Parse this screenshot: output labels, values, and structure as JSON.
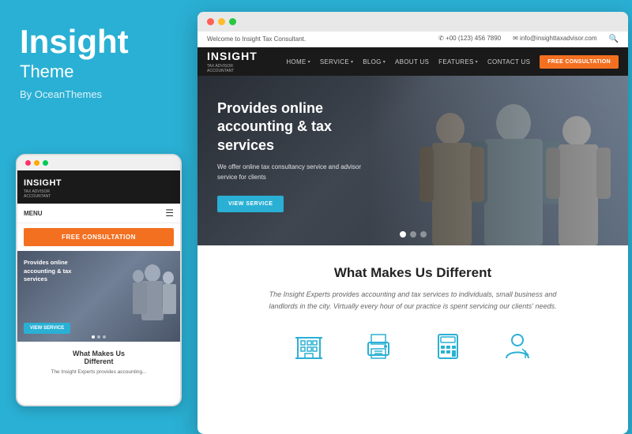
{
  "brand": {
    "title": "Insight",
    "subtitle": "Theme",
    "by": "By OceanThemes"
  },
  "mobile": {
    "logo": "INSIGHT",
    "logo_sub": "TAX ADVISOR\nACCOUNTANT",
    "menu_label": "MENU",
    "cta_btn": "FREE CONSULTATION",
    "hero_title": "Provides online accounting & tax services",
    "hero_btn": "VIEW SERVICE",
    "section_title": "What Makes Us\nDifferent"
  },
  "browser": {
    "topbar_welcome": "Welcome to Insight Tax Consultant.",
    "topbar_phone": "✆ +00 (123) 456 7890",
    "topbar_email": "✉ info@insighttaxadvisor.com",
    "logo": "INSIGHT",
    "logo_sub1": "TAX ADVISOR",
    "logo_sub2": "ACCOUNTANT",
    "nav": {
      "home": "HOME",
      "service": "SERVICE",
      "blog": "BLOG",
      "about": "ABOUT US",
      "features": "FEATURES",
      "contact": "CONTACT US",
      "cta": "FREE CONSULTATION"
    },
    "hero": {
      "title": "Provides online accounting & tax services",
      "subtitle": "We offer online tax consultancy service and advisor service for clients",
      "btn": "VIEW SERVICE"
    },
    "section": {
      "title": "What Makes Us Different",
      "text": "The Insight Experts provides accounting and tax services to individuals, small business and landlords in the city. Virtually every hour of our practice is spent servicing our clients' needs."
    },
    "icons": [
      {
        "name": "building-icon",
        "label": ""
      },
      {
        "name": "printer-icon",
        "label": ""
      },
      {
        "name": "calculator-icon",
        "label": ""
      },
      {
        "name": "person-icon",
        "label": ""
      }
    ]
  },
  "colors": {
    "accent": "#2ab0d4",
    "cta": "#f37021",
    "dark": "#1a1a1a",
    "text": "#333333"
  }
}
